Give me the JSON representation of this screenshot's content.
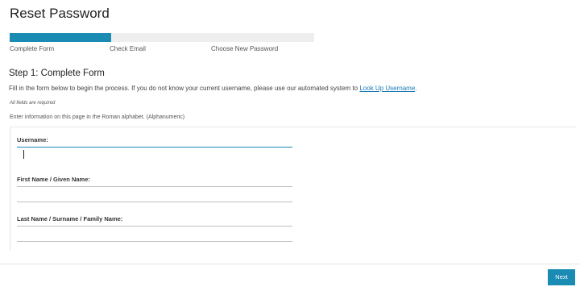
{
  "page": {
    "title": "Reset Password"
  },
  "progress": {
    "fraction": 0.333,
    "steps": [
      {
        "label": "Complete Form"
      },
      {
        "label": "Check Email"
      },
      {
        "label": "Choose New Password"
      }
    ]
  },
  "form": {
    "step_heading": "Step 1: Complete Form",
    "intro_text": "Fill in the form below to begin the process. If you do not know your current username, please use our automated system to ",
    "intro_link": "Look Up Username",
    "intro_end": ".",
    "required_note": "All fields are required",
    "alphabet_note": "Enter information on this page in the Roman alphabet. (Alphanumeric)",
    "fields": [
      {
        "label": "Username:",
        "value": ""
      },
      {
        "label": "First Name / Given Name:",
        "value": ""
      },
      {
        "label": "Last Name / Surname / Family Name:",
        "value": ""
      }
    ]
  },
  "footer": {
    "next_label": "Next"
  },
  "colors": {
    "accent": "#1a8bb3",
    "link": "#1a7ab5"
  }
}
